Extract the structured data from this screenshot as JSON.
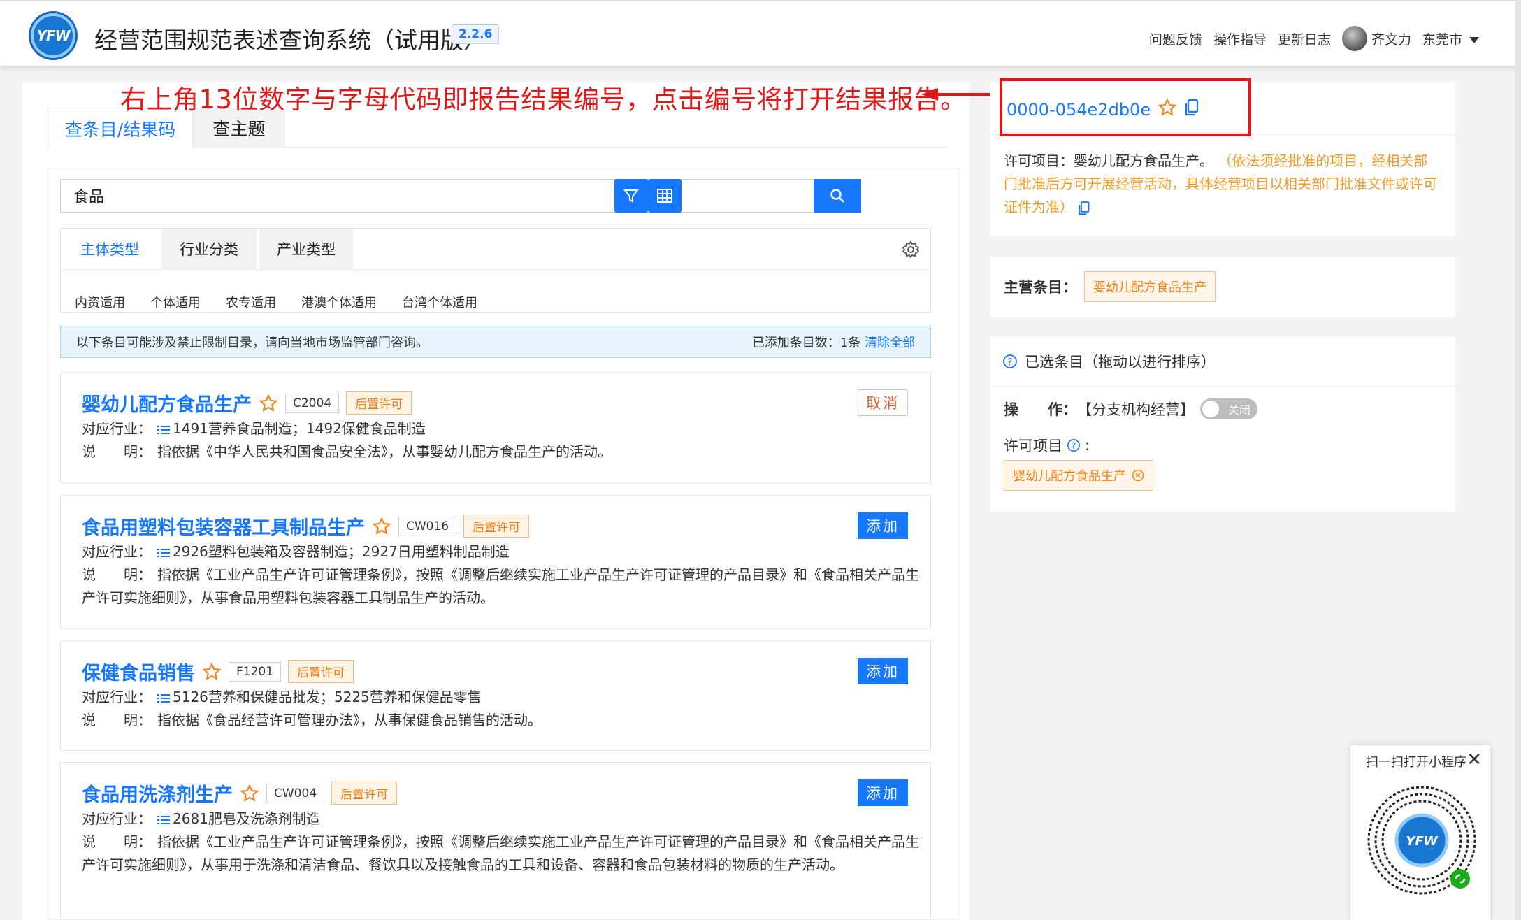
{
  "header": {
    "logo_text": "YFW",
    "title": "经营范围规范表述查询系统（试用版）",
    "version": "2.2.6",
    "links": [
      "问题反馈",
      "操作指导",
      "更新日志"
    ],
    "user_name": "齐文力",
    "city": "东莞市"
  },
  "annotation": {
    "text": "右上角13位数字与字母代码即报告结果编号，点击编号将打开结果报告。",
    "color": "#e01818"
  },
  "top_tabs": [
    "查条目/结果码",
    "查主题"
  ],
  "search": {
    "value": "食品"
  },
  "category_tabs": [
    "主体类型",
    "行业分类",
    "产业类型"
  ],
  "sub_filters": [
    "内资适用",
    "个体适用",
    "农专适用",
    "港澳个体适用",
    "台湾个体适用"
  ],
  "notice": {
    "text": "以下条目可能涉及禁止限制目录，请向当地市场监管部门咨询。",
    "added_count": "已添加条目数：1条",
    "clear_all": "清除全部"
  },
  "labels": {
    "industry": "对应行业：",
    "desc": "说　　明："
  },
  "results": [
    {
      "title": "婴幼儿配方食品生产",
      "code": "C2004",
      "badge": "后置许可",
      "action": "取消",
      "industry": "1491营养食品制造；1492保健食品制造",
      "desc": "指依据《中华人民共和国食品安全法》，从事婴幼儿配方食品生产的活动。"
    },
    {
      "title": "食品用塑料包装容器工具制品生产",
      "code": "CW016",
      "badge": "后置许可",
      "action": "添加",
      "industry": "2926塑料包装箱及容器制造；2927日用塑料制品制造",
      "desc": "指依据《工业产品生产许可证管理条例》，按照《调整后继续实施工业产品生产许可证管理的产品目录》和《食品相关产品生产许可实施细则》，从事食品用塑料包装容器工具制品生产的活动。"
    },
    {
      "title": "保健食品销售",
      "code": "F1201",
      "badge": "后置许可",
      "action": "添加",
      "industry": "5126营养和保健品批发；5225营养和保健品零售",
      "desc": "指依据《食品经营许可管理办法》，从事保健食品销售的活动。"
    },
    {
      "title": "食品用洗涤剂生产",
      "code": "CW004",
      "badge": "后置许可",
      "action": "添加",
      "industry": "2681肥皂及洗涤剂制造",
      "desc": "指依据《工业产品生产许可证管理条例》，按照《调整后继续实施工业产品生产许可证管理的产品目录》和《食品相关产品生产许可实施细则》，从事用于洗涤和清洁食品、餐饮具以及接触食品的工具和设备、容器和食品包装材料的物质的生产活动。"
    }
  ],
  "report": {
    "id": "0000-054e2db0e",
    "permit_label": "许可项目：婴幼儿配方食品生产。",
    "permit_note": "（依法须经批准的项目，经相关部门批准后方可开展经营活动，具体经营项目以相关部门批准文件或许可证件为准）"
  },
  "main_item": {
    "label": "主营条目：",
    "value": "婴幼儿配方食品生产"
  },
  "selected": {
    "title": "已选条目（拖动以进行排序）",
    "op_label": "操　　作：",
    "op_value": "【分支机构经营】",
    "toggle_label": "关闭",
    "permit_label": "许可项目",
    "permit_tag": "婴幼儿配方食品生产"
  },
  "qr": {
    "title": "扫一扫打开小程序"
  },
  "colors": {
    "accent": "#1677ff",
    "orange": "#f2831a",
    "red_annotation": "#e01818"
  }
}
